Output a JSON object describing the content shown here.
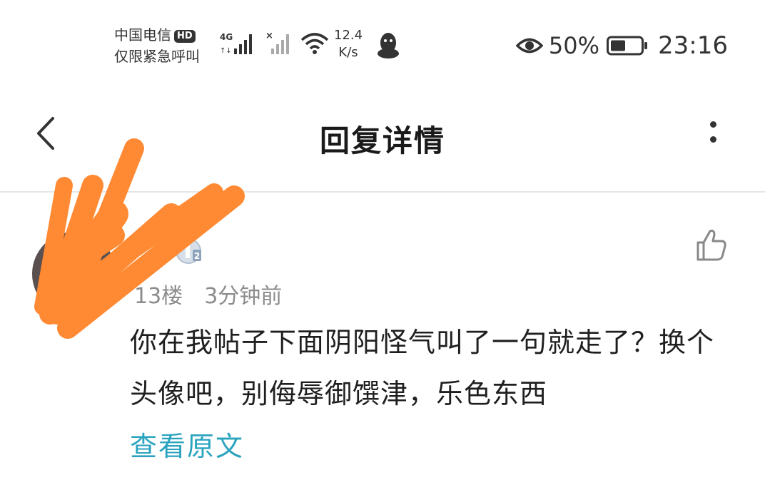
{
  "status_bar": {
    "carrier_name": "中国电信",
    "hd_label": "HD",
    "carrier_status": "仅限紧急呼叫",
    "network_type": "4G",
    "speed_value": "12.4",
    "speed_unit": "K/s",
    "battery_percent": "50%",
    "time": "23:16",
    "icons": [
      "signal-icon",
      "no-signal-icon",
      "wifi-icon",
      "qq-icon",
      "eye-icon",
      "battery-icon"
    ]
  },
  "header": {
    "title": "回复详情"
  },
  "reply": {
    "floor": "13楼",
    "time_ago": "3分钟前",
    "content": "你在我帖子下面阴阳怪气叫了一句就走了？换个头像吧，别侮辱御馔津，乐色东西",
    "view_original": "查看原文",
    "level_badge": "2"
  },
  "colors": {
    "link": "#2aa3bf",
    "scribble": "#ff8a33",
    "meta_text": "#8c8c8c"
  }
}
